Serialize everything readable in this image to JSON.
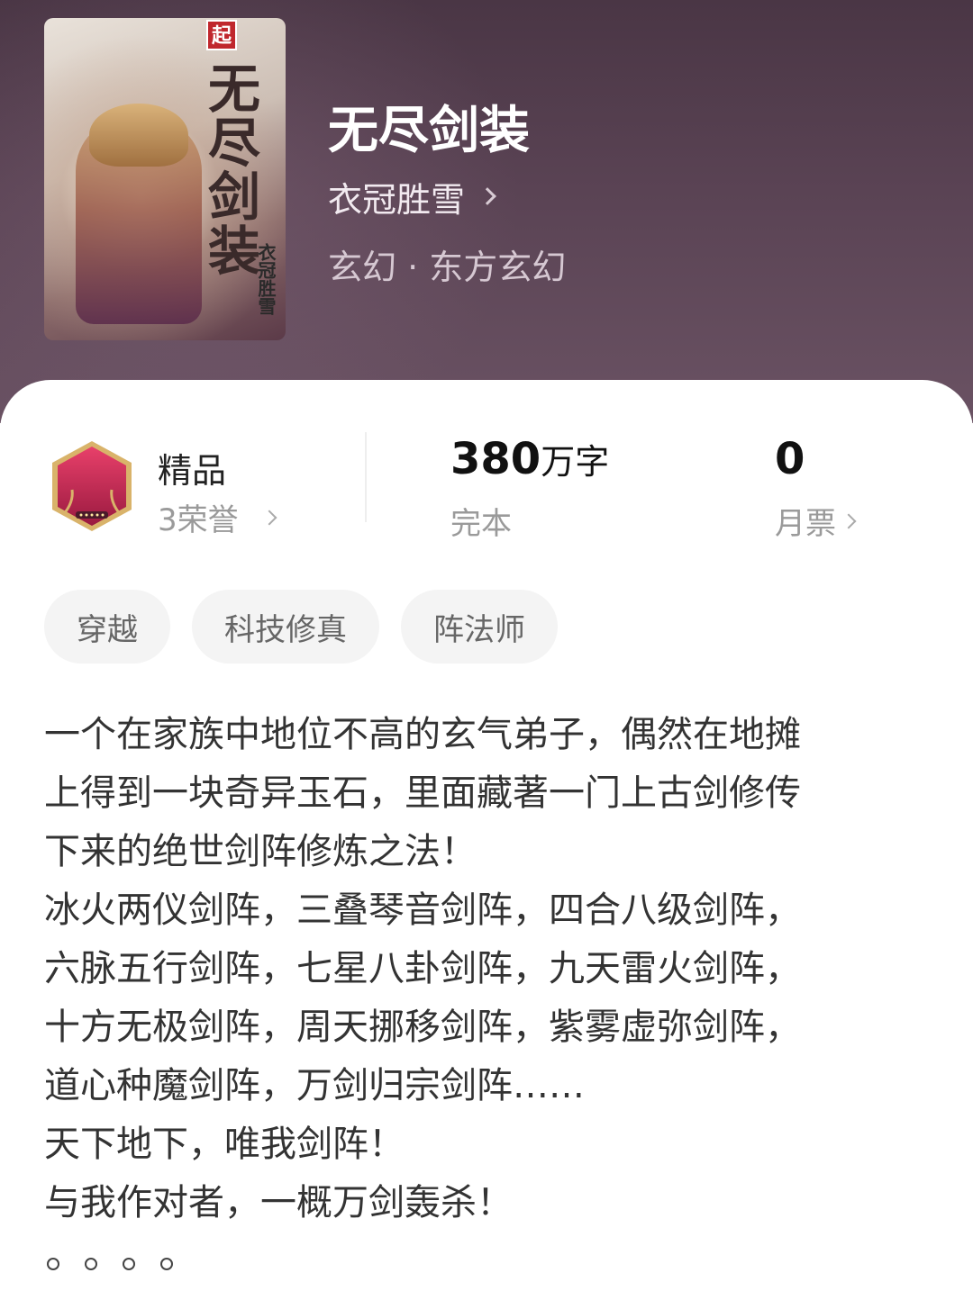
{
  "book": {
    "title": "无尽剑装",
    "author": "衣冠胜雪",
    "category": "玄幻 · 东方玄幻",
    "cover": {
      "badge": "起",
      "vertical_title": "无尽剑装",
      "vertical_author": "衣冠胜雪"
    }
  },
  "stats": {
    "quality": {
      "label": "精品",
      "sub": "3荣誉"
    },
    "words": {
      "number": "380",
      "unit": "万字",
      "sub": "完本"
    },
    "tickets": {
      "number": "0",
      "sub": "月票"
    }
  },
  "tags": [
    "穿越",
    "科技修真",
    "阵法师"
  ],
  "synopsis": [
    "一个在家族中地位不高的玄气弟子，偶然在地摊",
    "上得到一块奇异玉石，里面藏著一门上古剑修传",
    "下来的绝世剑阵修炼之法！",
    "冰火两仪剑阵，三叠琴音剑阵，四合八级剑阵，",
    "六脉五行剑阵，七星八卦剑阵，九天雷火剑阵，",
    "十方无极剑阵，周天挪移剑阵，紫雾虚弥剑阵，",
    "道心种魔剑阵，万剑归宗剑阵……",
    "天下地下，唯我剑阵！",
    "与我作对者，一概万剑轰杀！"
  ],
  "icons": {
    "author_chevron": "chevron-right-icon",
    "honor_chevron": "chevron-right-icon",
    "ticket_chevron": "chevron-right-icon",
    "medal": "premium-channel-medal-icon"
  },
  "colors": {
    "hero_bg": "#5a4354",
    "card_bg": "#ffffff",
    "tag_bg": "#f4f4f4",
    "medal_red": "#c4204a"
  }
}
